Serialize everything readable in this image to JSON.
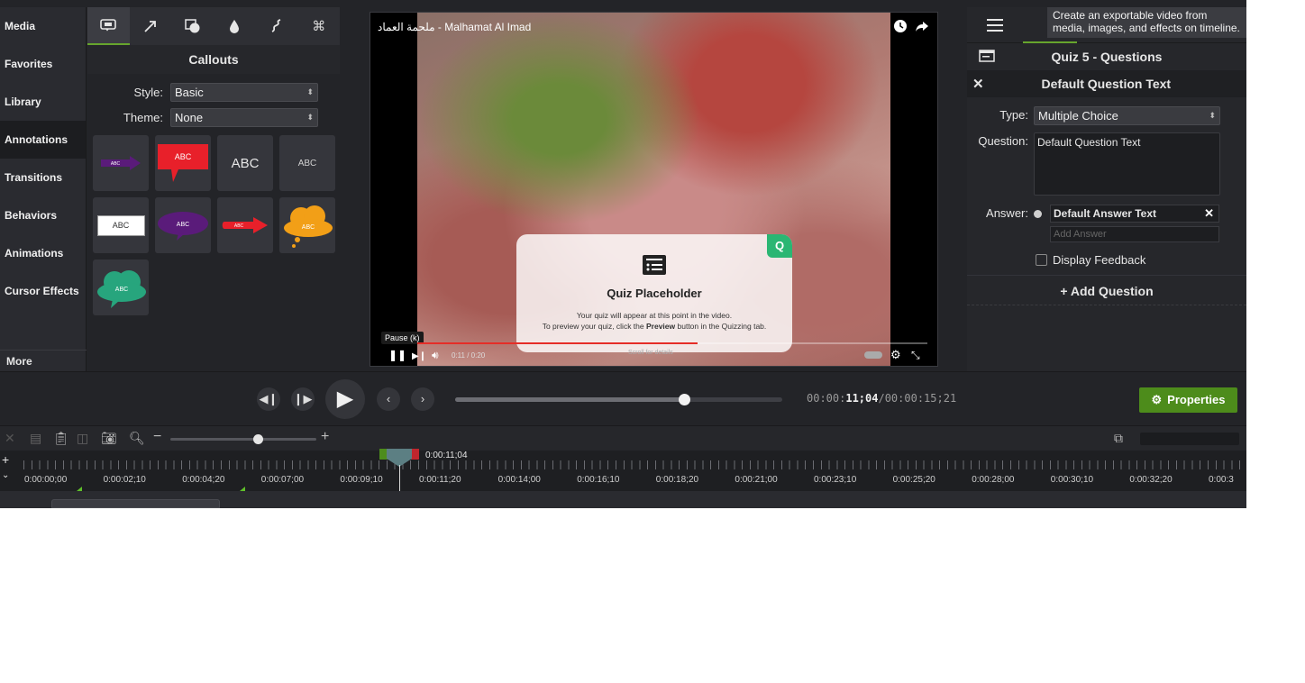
{
  "sidebar": {
    "items": [
      {
        "label": "Media"
      },
      {
        "label": "Favorites"
      },
      {
        "label": "Library"
      },
      {
        "label": "Annotations"
      },
      {
        "label": "Transitions"
      },
      {
        "label": "Behaviors"
      },
      {
        "label": "Animations"
      },
      {
        "label": "Cursor Effects"
      }
    ],
    "active": "Annotations",
    "more_label": "More"
  },
  "callouts": {
    "title": "Callouts",
    "style_label": "Style:",
    "style_value": "Basic",
    "theme_label": "Theme:",
    "theme_value": "None",
    "thumb_text": "ABC"
  },
  "preview": {
    "video_title": "ملحمة العماد - Malhamat Al Imad",
    "quiz_badge": "Q",
    "quiz_title": "Quiz Placeholder",
    "quiz_line1": "Your quiz will appear at this point in the video.",
    "quiz_line2_pre": "To preview your quiz, click the ",
    "quiz_line2_bold": "Preview",
    "quiz_line2_post": " button in the Quizzing tab.",
    "tooltip_pause": "Pause (k)",
    "time_text": "0:11 / 0:20",
    "scroll_details": "Scroll for details",
    "progress_fraction": 0.55
  },
  "properties_panel": {
    "quiz_header": "Quiz 5 - Questions",
    "question_header": "Default Question Text",
    "type_label": "Type:",
    "type_value": "Multiple Choice",
    "question_label": "Question:",
    "question_value": "Default Question Text",
    "answer_label": "Answer:",
    "answer_value": "Default Answer Text",
    "add_answer_placeholder": "Add Answer",
    "display_feedback_label": "Display Feedback",
    "add_question_label": "+ Add Question"
  },
  "top_tooltip": "Create an exportable video from media, images, and effects on timeline.",
  "transport": {
    "timecode_dim": "00:00:",
    "timecode_bright": "11;04",
    "timecode_total": "/00:00:15;21",
    "scrub_fraction": 0.7,
    "properties_label": "Properties"
  },
  "timeline": {
    "playhead_label": "0:00:11;04",
    "zoom_fraction": 0.6,
    "ruler_labels": [
      "0:00:00;00",
      "0:00:02;10",
      "0:00:04;20",
      "0:00:07;00",
      "0:00:09;10",
      "0:00:11;20",
      "0:00:14;00",
      "0:00:16;10",
      "0:00:18;20",
      "0:00:21;00",
      "0:00:23;10",
      "0:00:25;20",
      "0:00:28;00",
      "0:00:30;10",
      "0:00:32;20",
      "0:00:3"
    ]
  },
  "colors": {
    "accent_green": "#4d8c1b",
    "quiz_green": "#2bb673",
    "callout_red": "#e8202a",
    "callout_purple": "#5a1b7a",
    "callout_orange": "#f29f17",
    "callout_teal": "#27a57d"
  }
}
